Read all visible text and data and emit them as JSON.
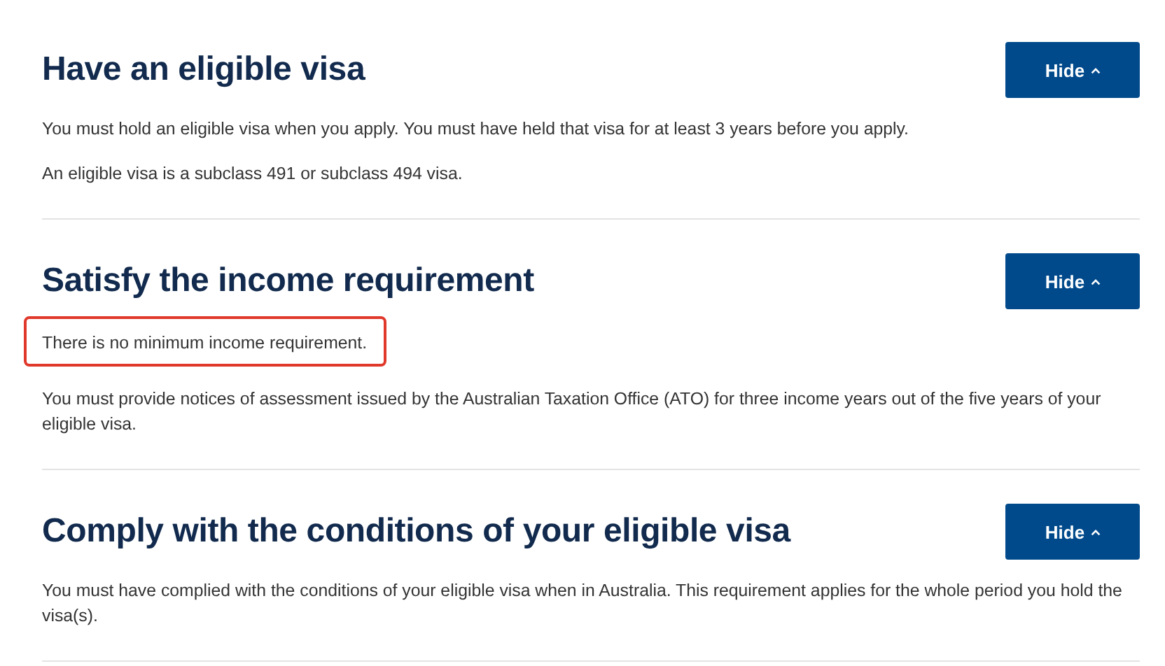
{
  "sections": [
    {
      "heading": "Have an eligible visa",
      "button": {
        "label": "Hide",
        "expanded": true
      },
      "paragraphs": [
        {
          "text": "You must hold an eligible visa when you apply. You must have held that visa for at least 3 years before you apply.",
          "highlighted": false
        },
        {
          "text": "An eligible visa is a subclass 491 or subclass 494 visa.",
          "highlighted": false
        }
      ]
    },
    {
      "heading": "Satisfy the income requirement",
      "button": {
        "label": "Hide",
        "expanded": true
      },
      "paragraphs": [
        {
          "text": "There is no minimum income requirement.",
          "highlighted": true
        },
        {
          "text": "You must provide notices of assessment issued by the Australian Taxation Office (ATO) for three income years out of the five years of your eligible visa.",
          "highlighted": false
        }
      ]
    },
    {
      "heading": "Comply with the conditions of your eligible visa",
      "button": {
        "label": "Hide",
        "expanded": true
      },
      "paragraphs": [
        {
          "text": "You must have complied with the conditions of your eligible visa when in Australia. This requirement applies for the whole period you hold the visa(s).",
          "highlighted": false
        }
      ]
    }
  ]
}
